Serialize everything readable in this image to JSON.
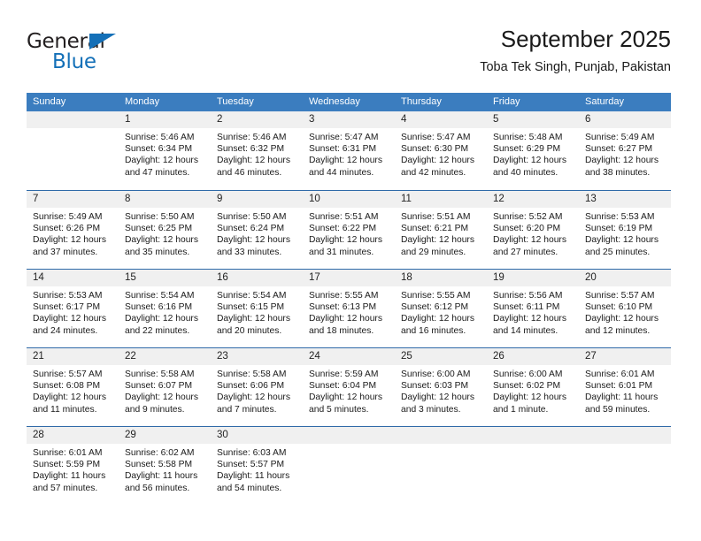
{
  "brand": {
    "name_top": "General",
    "name_bottom": "Blue",
    "accent_color": "#1470b8"
  },
  "header": {
    "title": "September 2025",
    "subtitle": "Toba Tek Singh, Punjab, Pakistan"
  },
  "calendar": {
    "header_bg": "#3b7dbf",
    "daynum_bg": "#f0f0f0",
    "row_divider_color": "#2f6aa8",
    "weekdays": [
      "Sunday",
      "Monday",
      "Tuesday",
      "Wednesday",
      "Thursday",
      "Friday",
      "Saturday"
    ],
    "weeks": [
      [
        {
          "day": "",
          "sunrise": "",
          "sunset": "",
          "daylight_line1": "",
          "daylight_line2": ""
        },
        {
          "day": "1",
          "sunrise": "Sunrise: 5:46 AM",
          "sunset": "Sunset: 6:34 PM",
          "daylight_line1": "Daylight: 12 hours",
          "daylight_line2": "and 47 minutes."
        },
        {
          "day": "2",
          "sunrise": "Sunrise: 5:46 AM",
          "sunset": "Sunset: 6:32 PM",
          "daylight_line1": "Daylight: 12 hours",
          "daylight_line2": "and 46 minutes."
        },
        {
          "day": "3",
          "sunrise": "Sunrise: 5:47 AM",
          "sunset": "Sunset: 6:31 PM",
          "daylight_line1": "Daylight: 12 hours",
          "daylight_line2": "and 44 minutes."
        },
        {
          "day": "4",
          "sunrise": "Sunrise: 5:47 AM",
          "sunset": "Sunset: 6:30 PM",
          "daylight_line1": "Daylight: 12 hours",
          "daylight_line2": "and 42 minutes."
        },
        {
          "day": "5",
          "sunrise": "Sunrise: 5:48 AM",
          "sunset": "Sunset: 6:29 PM",
          "daylight_line1": "Daylight: 12 hours",
          "daylight_line2": "and 40 minutes."
        },
        {
          "day": "6",
          "sunrise": "Sunrise: 5:49 AM",
          "sunset": "Sunset: 6:27 PM",
          "daylight_line1": "Daylight: 12 hours",
          "daylight_line2": "and 38 minutes."
        }
      ],
      [
        {
          "day": "7",
          "sunrise": "Sunrise: 5:49 AM",
          "sunset": "Sunset: 6:26 PM",
          "daylight_line1": "Daylight: 12 hours",
          "daylight_line2": "and 37 minutes."
        },
        {
          "day": "8",
          "sunrise": "Sunrise: 5:50 AM",
          "sunset": "Sunset: 6:25 PM",
          "daylight_line1": "Daylight: 12 hours",
          "daylight_line2": "and 35 minutes."
        },
        {
          "day": "9",
          "sunrise": "Sunrise: 5:50 AM",
          "sunset": "Sunset: 6:24 PM",
          "daylight_line1": "Daylight: 12 hours",
          "daylight_line2": "and 33 minutes."
        },
        {
          "day": "10",
          "sunrise": "Sunrise: 5:51 AM",
          "sunset": "Sunset: 6:22 PM",
          "daylight_line1": "Daylight: 12 hours",
          "daylight_line2": "and 31 minutes."
        },
        {
          "day": "11",
          "sunrise": "Sunrise: 5:51 AM",
          "sunset": "Sunset: 6:21 PM",
          "daylight_line1": "Daylight: 12 hours",
          "daylight_line2": "and 29 minutes."
        },
        {
          "day": "12",
          "sunrise": "Sunrise: 5:52 AM",
          "sunset": "Sunset: 6:20 PM",
          "daylight_line1": "Daylight: 12 hours",
          "daylight_line2": "and 27 minutes."
        },
        {
          "day": "13",
          "sunrise": "Sunrise: 5:53 AM",
          "sunset": "Sunset: 6:19 PM",
          "daylight_line1": "Daylight: 12 hours",
          "daylight_line2": "and 25 minutes."
        }
      ],
      [
        {
          "day": "14",
          "sunrise": "Sunrise: 5:53 AM",
          "sunset": "Sunset: 6:17 PM",
          "daylight_line1": "Daylight: 12 hours",
          "daylight_line2": "and 24 minutes."
        },
        {
          "day": "15",
          "sunrise": "Sunrise: 5:54 AM",
          "sunset": "Sunset: 6:16 PM",
          "daylight_line1": "Daylight: 12 hours",
          "daylight_line2": "and 22 minutes."
        },
        {
          "day": "16",
          "sunrise": "Sunrise: 5:54 AM",
          "sunset": "Sunset: 6:15 PM",
          "daylight_line1": "Daylight: 12 hours",
          "daylight_line2": "and 20 minutes."
        },
        {
          "day": "17",
          "sunrise": "Sunrise: 5:55 AM",
          "sunset": "Sunset: 6:13 PM",
          "daylight_line1": "Daylight: 12 hours",
          "daylight_line2": "and 18 minutes."
        },
        {
          "day": "18",
          "sunrise": "Sunrise: 5:55 AM",
          "sunset": "Sunset: 6:12 PM",
          "daylight_line1": "Daylight: 12 hours",
          "daylight_line2": "and 16 minutes."
        },
        {
          "day": "19",
          "sunrise": "Sunrise: 5:56 AM",
          "sunset": "Sunset: 6:11 PM",
          "daylight_line1": "Daylight: 12 hours",
          "daylight_line2": "and 14 minutes."
        },
        {
          "day": "20",
          "sunrise": "Sunrise: 5:57 AM",
          "sunset": "Sunset: 6:10 PM",
          "daylight_line1": "Daylight: 12 hours",
          "daylight_line2": "and 12 minutes."
        }
      ],
      [
        {
          "day": "21",
          "sunrise": "Sunrise: 5:57 AM",
          "sunset": "Sunset: 6:08 PM",
          "daylight_line1": "Daylight: 12 hours",
          "daylight_line2": "and 11 minutes."
        },
        {
          "day": "22",
          "sunrise": "Sunrise: 5:58 AM",
          "sunset": "Sunset: 6:07 PM",
          "daylight_line1": "Daylight: 12 hours",
          "daylight_line2": "and 9 minutes."
        },
        {
          "day": "23",
          "sunrise": "Sunrise: 5:58 AM",
          "sunset": "Sunset: 6:06 PM",
          "daylight_line1": "Daylight: 12 hours",
          "daylight_line2": "and 7 minutes."
        },
        {
          "day": "24",
          "sunrise": "Sunrise: 5:59 AM",
          "sunset": "Sunset: 6:04 PM",
          "daylight_line1": "Daylight: 12 hours",
          "daylight_line2": "and 5 minutes."
        },
        {
          "day": "25",
          "sunrise": "Sunrise: 6:00 AM",
          "sunset": "Sunset: 6:03 PM",
          "daylight_line1": "Daylight: 12 hours",
          "daylight_line2": "and 3 minutes."
        },
        {
          "day": "26",
          "sunrise": "Sunrise: 6:00 AM",
          "sunset": "Sunset: 6:02 PM",
          "daylight_line1": "Daylight: 12 hours",
          "daylight_line2": "and 1 minute."
        },
        {
          "day": "27",
          "sunrise": "Sunrise: 6:01 AM",
          "sunset": "Sunset: 6:01 PM",
          "daylight_line1": "Daylight: 11 hours",
          "daylight_line2": "and 59 minutes."
        }
      ],
      [
        {
          "day": "28",
          "sunrise": "Sunrise: 6:01 AM",
          "sunset": "Sunset: 5:59 PM",
          "daylight_line1": "Daylight: 11 hours",
          "daylight_line2": "and 57 minutes."
        },
        {
          "day": "29",
          "sunrise": "Sunrise: 6:02 AM",
          "sunset": "Sunset: 5:58 PM",
          "daylight_line1": "Daylight: 11 hours",
          "daylight_line2": "and 56 minutes."
        },
        {
          "day": "30",
          "sunrise": "Sunrise: 6:03 AM",
          "sunset": "Sunset: 5:57 PM",
          "daylight_line1": "Daylight: 11 hours",
          "daylight_line2": "and 54 minutes."
        },
        {
          "day": "",
          "sunrise": "",
          "sunset": "",
          "daylight_line1": "",
          "daylight_line2": ""
        },
        {
          "day": "",
          "sunrise": "",
          "sunset": "",
          "daylight_line1": "",
          "daylight_line2": ""
        },
        {
          "day": "",
          "sunrise": "",
          "sunset": "",
          "daylight_line1": "",
          "daylight_line2": ""
        },
        {
          "day": "",
          "sunrise": "",
          "sunset": "",
          "daylight_line1": "",
          "daylight_line2": ""
        }
      ]
    ]
  }
}
